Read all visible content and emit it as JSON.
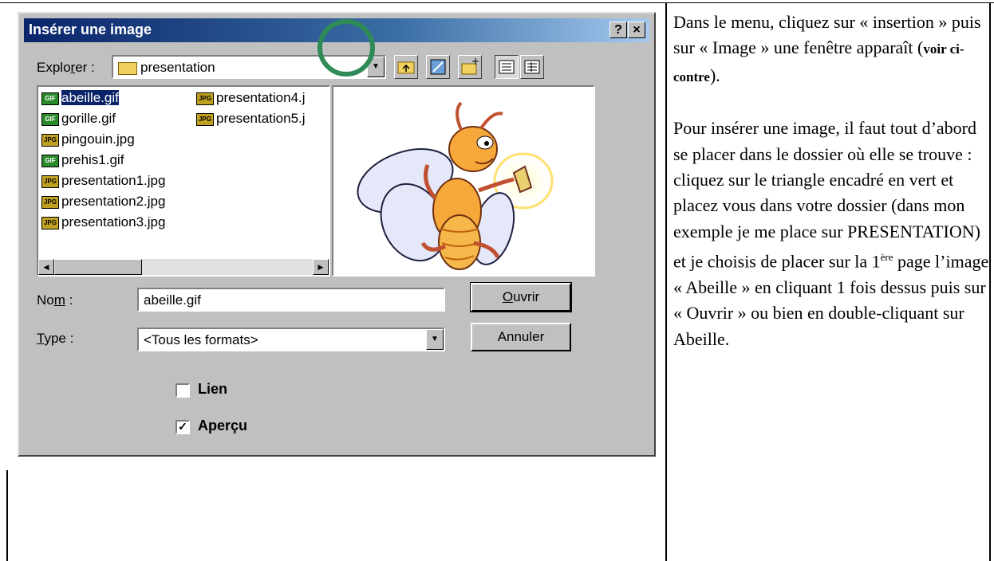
{
  "dialog": {
    "title": "Insérer une image",
    "help_label": "?",
    "close_label": "×",
    "look_in_prefix": "Explo",
    "look_in_accel": "r",
    "look_in_suffix": "er :",
    "look_in_value": "presentation",
    "files": [
      {
        "name": "abeille.gif",
        "type": "GIF",
        "selected": true
      },
      {
        "name": "gorille.gif",
        "type": "GIF"
      },
      {
        "name": "pingouin.jpg",
        "type": "JPG"
      },
      {
        "name": "prehis1.gif",
        "type": "GIF"
      },
      {
        "name": "presentation1.jpg",
        "type": "JPG"
      },
      {
        "name": "presentation2.jpg",
        "type": "JPG"
      },
      {
        "name": "presentation3.jpg",
        "type": "JPG"
      },
      {
        "name": "presentation4.j",
        "type": "JPG"
      },
      {
        "name": "presentation5.j",
        "type": "JPG"
      }
    ],
    "name_label_prefix": "No",
    "name_label_accel": "m",
    "name_label_suffix": " :",
    "name_value": "abeille.gif",
    "type_label_accel": "T",
    "type_label_suffix": "ype :",
    "type_value": "<Tous les formats>",
    "open_accel": "O",
    "open_rest": "uvrir",
    "cancel_label": "Annuler",
    "link_label": "Lien",
    "link_checked": false,
    "preview_label": "Aperçu",
    "preview_checked": true,
    "highlight_color": "#2e8b57"
  },
  "instructions": {
    "p1_a": "Dans le menu, cliquez sur « insertion » puis sur « Image » une fenêtre apparaît (",
    "p1_bold": "voir ci-contre",
    "p1_b": ").",
    "p2_a": "Pour insérer une image, il faut tout d’abord se placer dans le dossier où elle se trouve : cliquez sur le triangle encadré en vert et placez vous dans votre dossier (dans mon exemple je me place sur PRESENTATION) et je choisis de placer sur la 1",
    "p2_sup": "ère",
    "p2_b": " page l’image « Abeille » en cliquant 1 fois dessus puis sur « Ouvrir » ou bien en double-cliquant sur Abeille."
  }
}
